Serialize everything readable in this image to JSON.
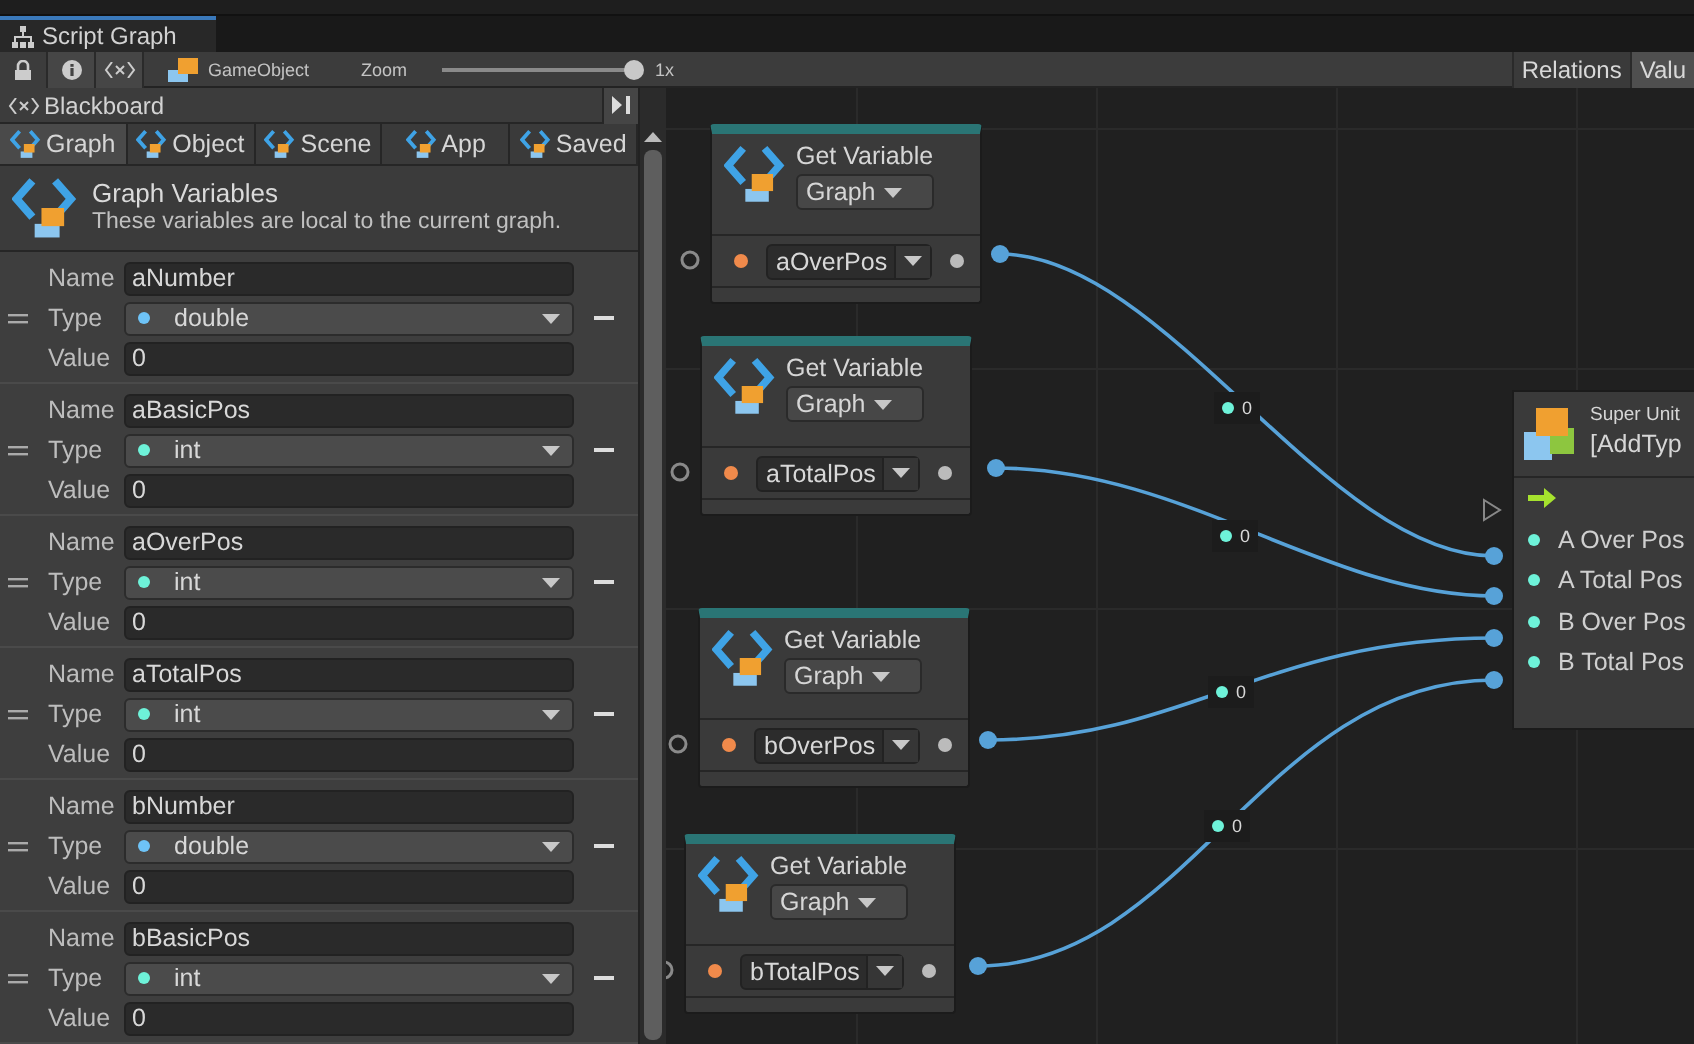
{
  "window": {
    "tab": "Script Graph"
  },
  "toolbar": {
    "target": "GameObject",
    "zoom_label": "Zoom",
    "zoom": {
      "level": 1
    },
    "zoom_reading": "1x",
    "right_tabs": [
      {
        "label": "Relations",
        "selected": false
      },
      {
        "label": "Valu",
        "selected": true
      }
    ]
  },
  "blackboard": {
    "title": "Blackboard",
    "tabs": [
      {
        "label": "Graph",
        "selected": true
      },
      {
        "label": "Object",
        "selected": false
      },
      {
        "label": "Scene",
        "selected": false
      },
      {
        "label": "App",
        "selected": false
      },
      {
        "label": "Saved",
        "selected": false
      }
    ],
    "heading": "Graph Variables",
    "description": "These variables are local to the current graph.",
    "variables": [
      {
        "name_label": "Name",
        "name": "aNumber",
        "type_label": "Type",
        "type": "double",
        "color": "#6ec3f7",
        "value_label": "Value",
        "value": "0"
      },
      {
        "name_label": "Name",
        "name": "aBasicPos",
        "type_label": "Type",
        "type": "int",
        "color": "#6ef2d9",
        "value_label": "Value",
        "value": "0"
      },
      {
        "name_label": "Name",
        "name": "aOverPos",
        "type_label": "Type",
        "type": "int",
        "color": "#6ef2d9",
        "value_label": "Value",
        "value": "0"
      },
      {
        "name_label": "Name",
        "name": "aTotalPos",
        "type_label": "Type",
        "type": "int",
        "color": "#6ef2d9",
        "value_label": "Value",
        "value": "0"
      },
      {
        "name_label": "Name",
        "name": "bNumber",
        "type_label": "Type",
        "type": "double",
        "color": "#6ec3f7",
        "value_label": "Value",
        "value": "0"
      },
      {
        "name_label": "Name",
        "name": "bBasicPos",
        "type_label": "Type",
        "type": "int",
        "color": "#6ef2d9",
        "value_label": "Value",
        "value": "0"
      }
    ]
  },
  "graph": {
    "nodes": [
      {
        "title": "Get Variable",
        "scope": "Graph",
        "variable": "aOverPos"
      },
      {
        "title": "Get Variable",
        "scope": "Graph",
        "variable": "aTotalPos"
      },
      {
        "title": "Get Variable",
        "scope": "Graph",
        "variable": "bOverPos"
      },
      {
        "title": "Get Variable",
        "scope": "Graph",
        "variable": "bTotalPos"
      }
    ],
    "wire_values": [
      "0",
      "0",
      "0",
      "0"
    ],
    "super_unit": {
      "title": "Super Unit",
      "subtitle": "[AddTyp",
      "ports": [
        "A Over Pos",
        "A Total Pos",
        "B Over Pos",
        "B Total Pos"
      ]
    }
  }
}
